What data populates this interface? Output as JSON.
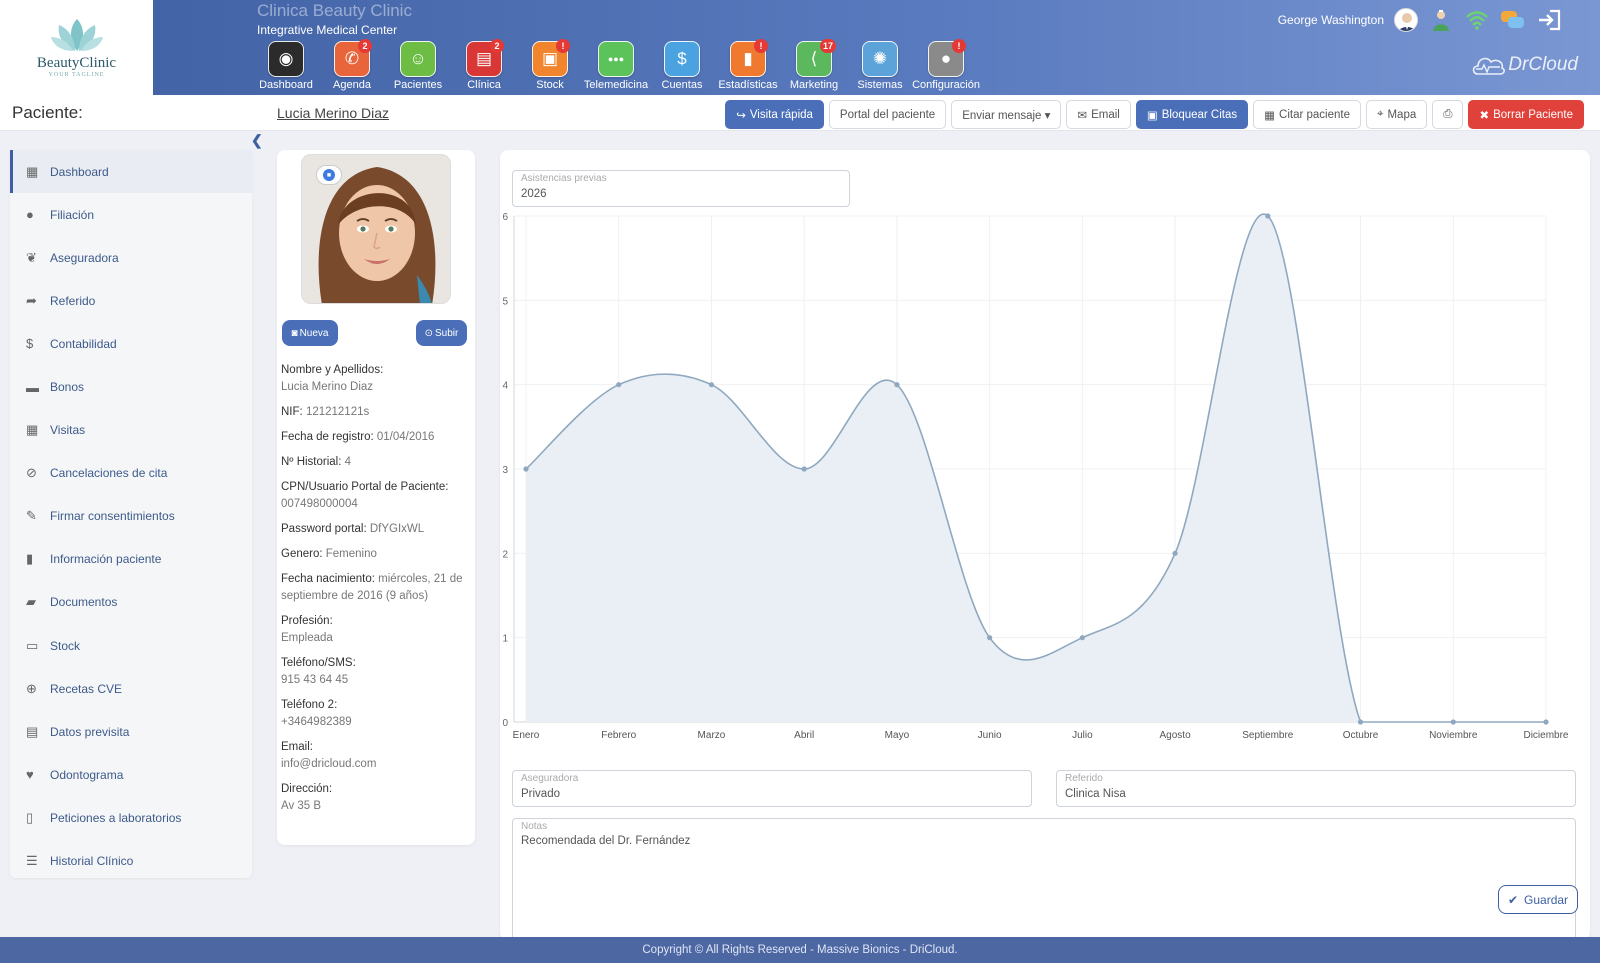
{
  "brand": {
    "logo_name": "BeautyClinic",
    "logo_tagline": "YOUR TAGLINE",
    "clinic_name": "Clinica Beauty Clinic",
    "clinic_subtitle": "Integrative Medical Center",
    "product": "DrCloud"
  },
  "nav": [
    {
      "label": "Dashboard",
      "icon": "speedometer-icon",
      "color": "#2b2b2b",
      "badge": ""
    },
    {
      "label": "Agenda",
      "icon": "phone-icon",
      "color": "#e8643a",
      "badge": "2"
    },
    {
      "label": "Pacientes",
      "icon": "patient-icon",
      "color": "#6dbd45",
      "badge": ""
    },
    {
      "label": "Clínica",
      "icon": "clipboard-icon",
      "color": "#d93636",
      "badge": "2"
    },
    {
      "label": "Stock",
      "icon": "box-icon",
      "color": "#f0852d",
      "badge": "!"
    },
    {
      "label": "Telemedicina",
      "icon": "chat-icon",
      "color": "#5cc35a",
      "badge": ""
    },
    {
      "label": "Cuentas",
      "icon": "money-hand-icon",
      "color": "#4aa3e0",
      "badge": ""
    },
    {
      "label": "Estadísticas",
      "icon": "bar-chart-icon",
      "color": "#ef7a2f",
      "badge": "!"
    },
    {
      "label": "Marketing",
      "icon": "share-icon",
      "color": "#5cb85c",
      "badge": "17"
    },
    {
      "label": "Sistemas",
      "icon": "gear-icon",
      "color": "#5ba3d9",
      "badge": ""
    },
    {
      "label": "Configuración",
      "icon": "user-settings-icon",
      "color": "#8a8a8a",
      "badge": "!"
    }
  ],
  "user": {
    "name": "George Washington"
  },
  "patient_bar": {
    "label": "Paciente:",
    "name": "Lucia Merino Diaz",
    "actions": [
      {
        "label": "Visita rápida",
        "icon": "↪",
        "style": "blue",
        "name": "quick-visit-button"
      },
      {
        "label": "Portal del paciente",
        "icon": "",
        "style": "",
        "name": "patient-portal-button"
      },
      {
        "label": "Enviar mensaje ▾",
        "icon": "",
        "style": "",
        "name": "send-message-dropdown"
      },
      {
        "label": "Email",
        "icon": "✉",
        "style": "",
        "name": "email-button"
      },
      {
        "label": "Bloquear Citas",
        "icon": "▣",
        "style": "blue",
        "name": "block-appointments-button"
      },
      {
        "label": "Citar paciente",
        "icon": "▦",
        "style": "",
        "name": "schedule-patient-button"
      },
      {
        "label": "Mapa",
        "icon": "⌖",
        "style": "",
        "name": "map-button"
      },
      {
        "label": "",
        "icon": "⎙",
        "style": "",
        "name": "print-button"
      },
      {
        "label": "Borrar Paciente",
        "icon": "✖",
        "style": "red",
        "name": "delete-patient-button"
      }
    ]
  },
  "sidebar": [
    {
      "label": "Dashboard",
      "icon": "▦",
      "active": true
    },
    {
      "label": "Filiación",
      "icon": "●",
      "active": false
    },
    {
      "label": "Aseguradora",
      "icon": "❦",
      "active": false
    },
    {
      "label": "Referido",
      "icon": "➦",
      "active": false
    },
    {
      "label": "Contabilidad",
      "icon": "$",
      "active": false
    },
    {
      "label": "Bonos",
      "icon": "▬",
      "active": false
    },
    {
      "label": "Visitas",
      "icon": "▦",
      "active": false
    },
    {
      "label": "Cancelaciones de cita",
      "icon": "⊘",
      "active": false
    },
    {
      "label": "Firmar consentimientos",
      "icon": "✎",
      "active": false
    },
    {
      "label": "Información paciente",
      "icon": "▮",
      "active": false
    },
    {
      "label": "Documentos",
      "icon": "▰",
      "active": false
    },
    {
      "label": "Stock",
      "icon": "▭",
      "active": false
    },
    {
      "label": "Recetas CVE",
      "icon": "⊕",
      "active": false
    },
    {
      "label": "Datos previsita",
      "icon": "▤",
      "active": false
    },
    {
      "label": "Odontograma",
      "icon": "♥",
      "active": false
    },
    {
      "label": "Peticiones a laboratorios",
      "icon": "▯",
      "active": false
    },
    {
      "label": "Historial Clínico",
      "icon": "☰",
      "active": false
    }
  ],
  "patient_card": {
    "btn_new": "Nueva",
    "btn_upload": "Subir",
    "fields": [
      {
        "key": "Nombre y Apellidos:",
        "value": "Lucia Merino Diaz",
        "block": true
      },
      {
        "key": "NIF:",
        "value": "121212121s",
        "block": false
      },
      {
        "key": "Fecha de registro:",
        "value": "01/04/2016",
        "block": false
      },
      {
        "key": "Nº Historial:",
        "value": "4",
        "block": false
      },
      {
        "key": "CPN/Usuario Portal de Paciente:",
        "value": "007498000004",
        "block": true
      },
      {
        "key": "Password portal:",
        "value": "DfYGIxWL",
        "block": false
      },
      {
        "key": "Genero:",
        "value": "Femenino",
        "block": false
      },
      {
        "key": "Fecha nacimiento:",
        "value": "miércoles, 21 de septiembre de 2016 (9 años)",
        "block": false
      },
      {
        "key": "Profesión:",
        "value": "Empleada",
        "block": true
      },
      {
        "key": "Teléfono/SMS:",
        "value": "915 43 64 45",
        "block": true
      },
      {
        "key": "Teléfono 2:",
        "value": "+3464982389",
        "block": true
      },
      {
        "key": "Email:",
        "value": "info@dricloud.com",
        "block": true
      },
      {
        "key": "Dirección:",
        "value": "Av 35 B",
        "block": true
      }
    ]
  },
  "main": {
    "year_field": {
      "label": "Asistencias previas",
      "value": "2026"
    },
    "insurer": {
      "label": "Aseguradora",
      "value": "Privado"
    },
    "referred": {
      "label": "Referido",
      "value": "Clinica Nisa"
    },
    "notes": {
      "label": "Notas",
      "value": "Recomendada del Dr. Fernández"
    },
    "save_label": "Guardar"
  },
  "chart_data": {
    "type": "area",
    "categories": [
      "Enero",
      "Febrero",
      "Marzo",
      "Abril",
      "Mayo",
      "Junio",
      "Julio",
      "Agosto",
      "Septiembre",
      "Octubre",
      "Noviembre",
      "Diciembre"
    ],
    "values": [
      3,
      4,
      4,
      3,
      4,
      1,
      1,
      2,
      6,
      0,
      0,
      0
    ],
    "ylim": [
      0,
      6
    ],
    "yticks": [
      0,
      1,
      2,
      3,
      4,
      5,
      6
    ],
    "grid": true,
    "fill_color": "#e9eff4",
    "line_color": "#8fa8c0"
  },
  "footer": {
    "text": "Copyright © All Rights Reserved - Massive Bionics - DriCloud."
  }
}
